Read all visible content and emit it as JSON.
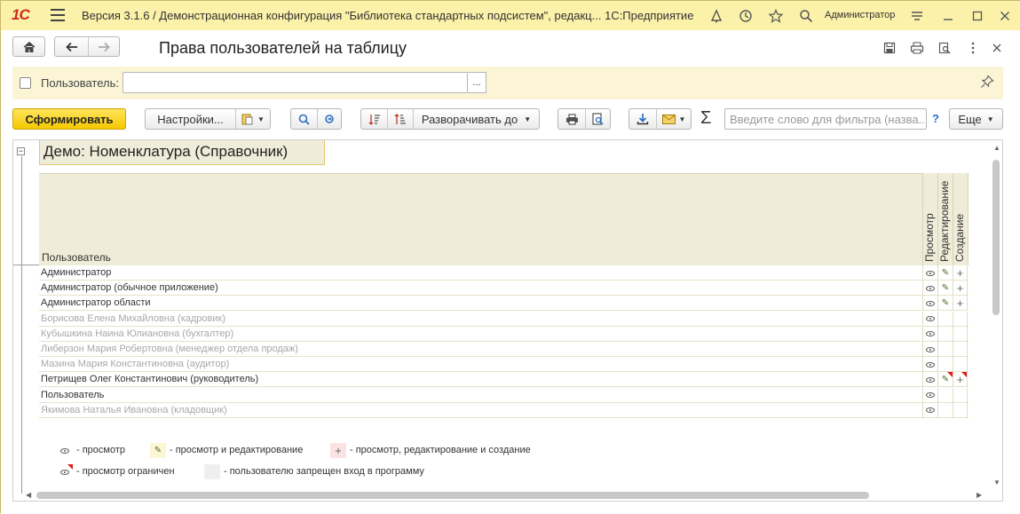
{
  "titlebar": {
    "logo": "1С",
    "title": "Версия 3.1.6 / Демонстрационная конфигурация \"Библиотека стандартных подсистем\", редакц...  1С:Предприятие",
    "user": "Администратор"
  },
  "page": {
    "title": "Права пользователей на таблицу"
  },
  "filter": {
    "label": "Пользователь:",
    "value": "",
    "pick_label": "..."
  },
  "toolbar": {
    "generate_label": "Сформировать",
    "settings_label": "Настройки...",
    "expand_label": "Разворачивать до",
    "search_placeholder": "Введите слово для фильтра (назва...",
    "help_label": "?",
    "more_label": "Еще",
    "sigma_label": "Σ"
  },
  "report": {
    "group_title": "Демо: Номенклатура (Справочник)",
    "columns": {
      "user": "Пользователь",
      "view": "Просмотр",
      "edit": "Редактирование",
      "create": "Создание"
    },
    "rows": [
      {
        "name": "Администратор",
        "disabled": false,
        "view": true,
        "edit": true,
        "create": true,
        "restricted": false
      },
      {
        "name": "Администратор (обычное приложение)",
        "disabled": false,
        "view": true,
        "edit": true,
        "create": true,
        "restricted": false
      },
      {
        "name": "Администратор области",
        "disabled": false,
        "view": true,
        "edit": true,
        "create": true,
        "restricted": false
      },
      {
        "name": "Борисова Елена Михайловна (кадровик)",
        "disabled": true,
        "view": true,
        "edit": false,
        "create": false,
        "restricted": false
      },
      {
        "name": "Кубышкина Наина Юлиановна (бухгалтер)",
        "disabled": true,
        "view": true,
        "edit": false,
        "create": false,
        "restricted": false
      },
      {
        "name": "Либерзон Мария Робертовна (менеджер отдела продаж)",
        "disabled": true,
        "view": true,
        "edit": false,
        "create": false,
        "restricted": false
      },
      {
        "name": "Мазина Мария Константиновна (аудитор)",
        "disabled": true,
        "view": true,
        "edit": false,
        "create": false,
        "restricted": false
      },
      {
        "name": "Петрищев Олег Константинович (руководитель)",
        "disabled": false,
        "view": true,
        "edit": true,
        "create": true,
        "restricted": true
      },
      {
        "name": "Пользователь",
        "disabled": false,
        "view": true,
        "edit": false,
        "create": false,
        "restricted": false
      },
      {
        "name": "Якимова Наталья Ивановна (кладовщик)",
        "disabled": true,
        "view": true,
        "edit": false,
        "create": false,
        "restricted": false
      }
    ],
    "legend": {
      "view": "- просмотр",
      "view_edit": "- просмотр и редактирование",
      "view_edit_create": "- просмотр, редактирование и создание",
      "restricted": "- просмотр ограничен",
      "login_denied": "- пользователю запрещен вход в программу"
    }
  },
  "colors": {
    "accent_yellow": "#f5c800",
    "panel_bg": "#fbf1a9",
    "flag_red": "#e21b1b"
  }
}
